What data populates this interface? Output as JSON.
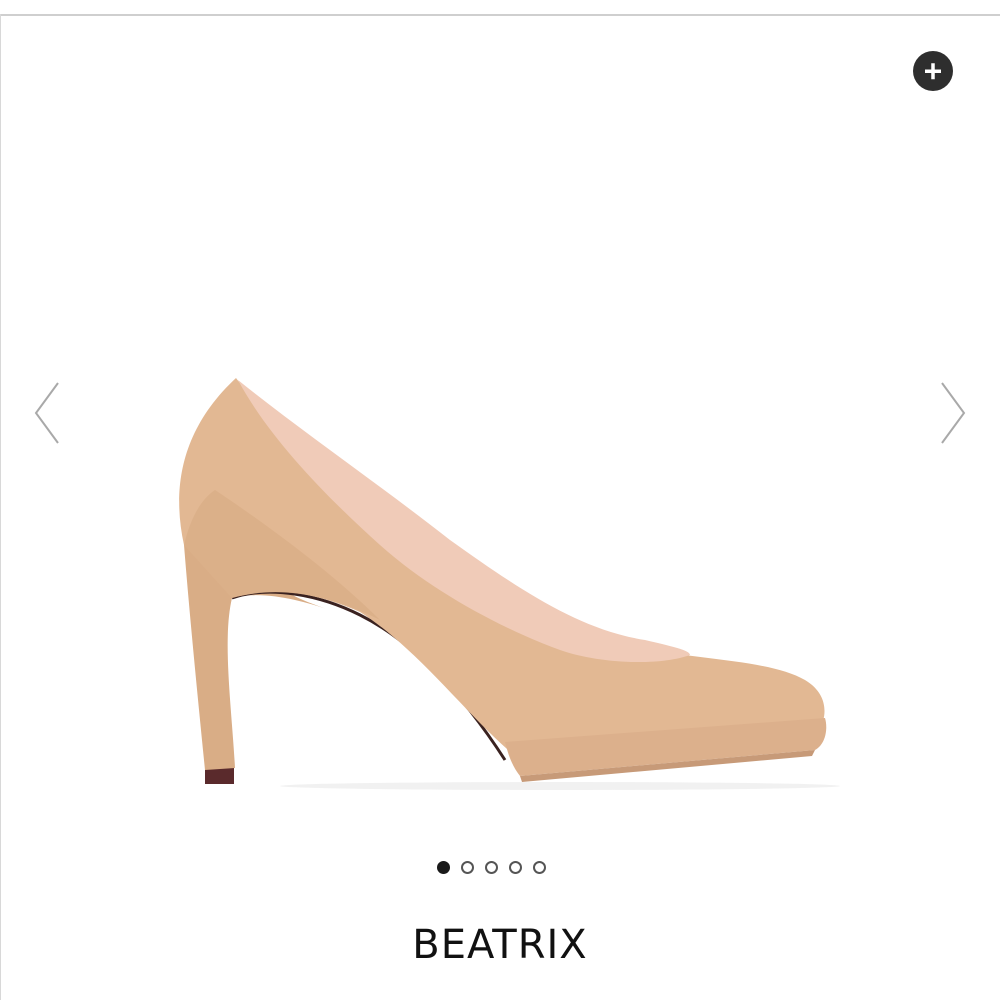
{
  "product": {
    "name": "BEATRIX"
  },
  "gallery": {
    "image_count": 5,
    "active_index": 0,
    "zoom_icon": "plus-circle-icon",
    "prev_icon": "chevron-left-icon",
    "next_icon": "chevron-right-icon"
  },
  "colors": {
    "shoe": "#e2b893",
    "shoe_shadow": "#c99e79",
    "lining": "#f0cbb8",
    "sole_accent": "#5a2a2c"
  }
}
